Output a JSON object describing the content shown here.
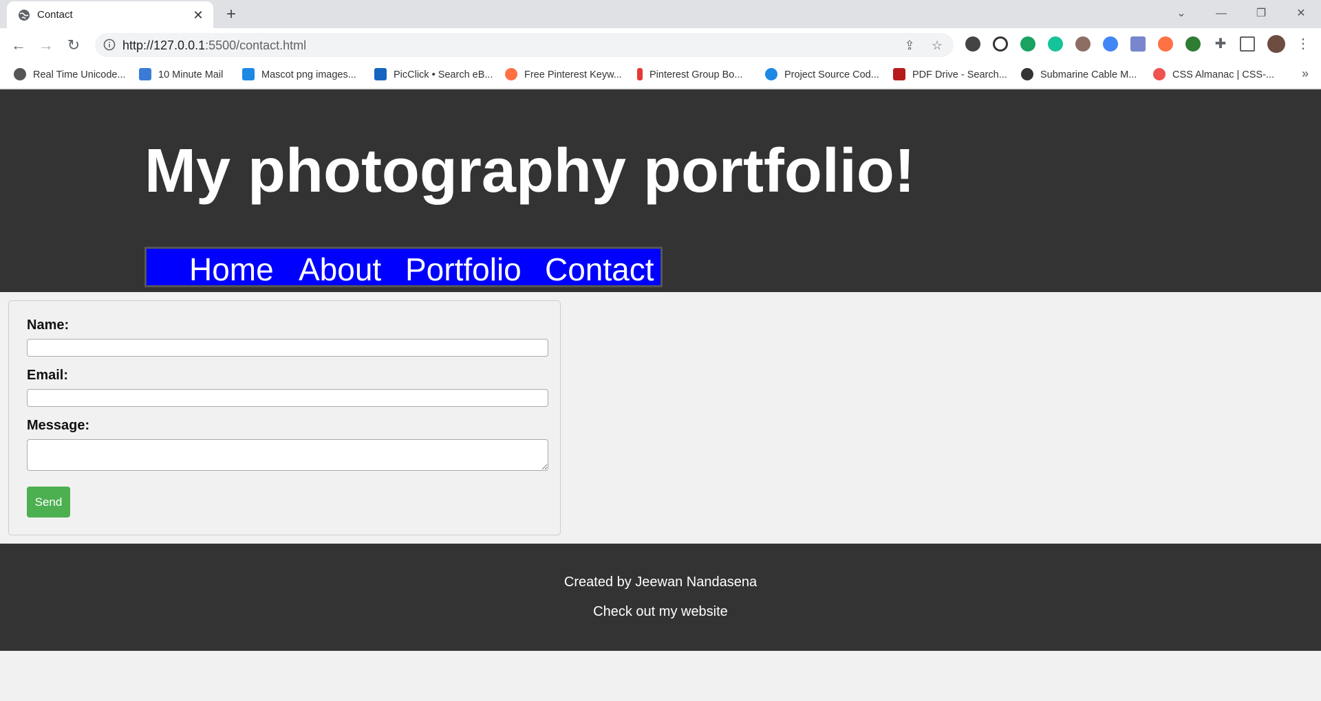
{
  "browser": {
    "tab_title": "Contact",
    "url_host": "http://127.0.0.1",
    "url_rest": ":5500/contact.html",
    "bookmarks": [
      {
        "label": "Real Time Unicode...",
        "color": "#555555"
      },
      {
        "label": "10 Minute Mail",
        "color": "#3b7bd6"
      },
      {
        "label": "Mascot png images...",
        "color": "#1e88e5"
      },
      {
        "label": "PicClick • Search eB...",
        "color": "#1565c0"
      },
      {
        "label": "Free Pinterest Keyw...",
        "color": "#ff7043"
      },
      {
        "label": "Pinterest Group Bo...",
        "color": "#e53935"
      },
      {
        "label": "Project Source Cod...",
        "color": "#1e88e5"
      },
      {
        "label": "PDF Drive - Search...",
        "color": "#b71c1c"
      },
      {
        "label": "Submarine Cable M...",
        "color": "#333333"
      },
      {
        "label": "CSS Almanac | CSS-...",
        "color": "#ef5350"
      }
    ]
  },
  "site": {
    "title": "My photography portfolio!",
    "nav": [
      "Home",
      "About",
      "Portfolio",
      "Contact"
    ],
    "form": {
      "name_label": "Name:",
      "email_label": "Email:",
      "message_label": "Message:",
      "name_value": "",
      "email_value": "",
      "message_value": "",
      "send_label": "Send"
    },
    "footer": {
      "credit": "Created by Jeewan Nandasena",
      "link": "Check out my website"
    }
  },
  "colors": {
    "header_bg": "#333333",
    "nav_bg": "#0000ff",
    "send_bg": "#4caf50",
    "page_bg": "#f1f1f1"
  }
}
